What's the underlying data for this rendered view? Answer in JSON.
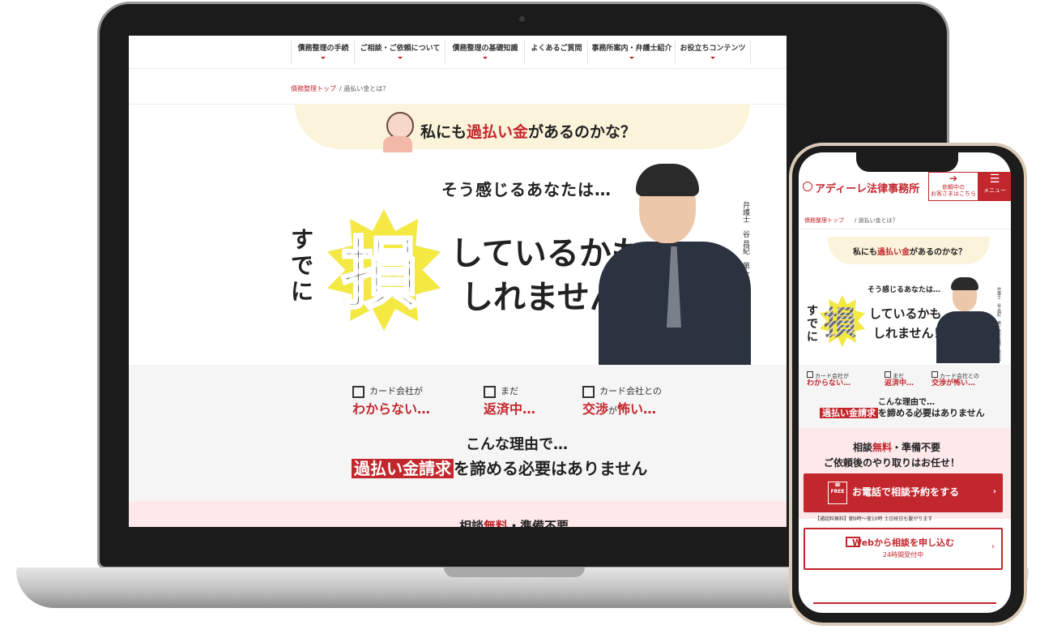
{
  "desktop": {
    "nav": [
      {
        "label": "債務整理の手続"
      },
      {
        "label": "ご相談・ご依頼について"
      },
      {
        "label": "債務整理の基礎知識"
      },
      {
        "label": "よくあるご質問"
      },
      {
        "label": "事務所案内・弁護士紹介"
      },
      {
        "label": "お役立ちコンテンツ"
      }
    ],
    "breadcrumb": {
      "home": "債務整理トップ",
      "separator": "/",
      "current": "過払い金とは？"
    },
    "hero": {
      "bubble_pre": "私にも",
      "bubble_hl": "過払い金",
      "bubble_post": "があるのかな？",
      "sou": "そう感じるあなたは…",
      "sude": "すでに",
      "son": "損",
      "line1": "しているかも",
      "line2": "しれません！",
      "lawyer": "弁護士　谷 昌紀　第一東京弁護士会所属"
    },
    "checks": [
      {
        "pre": "カード会社が",
        "main": "わからない…"
      },
      {
        "pre": "まだ",
        "main": "返済中…"
      },
      {
        "pre": "カード会社との",
        "main": "交渉",
        "suffix": "が",
        "main2": "怖い…"
      }
    ],
    "reason": "こんな理由で…",
    "claim_hl": "過払い金請求",
    "claim_rest": "を諦める必要はありません",
    "soudan_pre": "相談",
    "soudan_hl": "無料",
    "soudan_post": "・準備不要"
  },
  "mobile": {
    "logo": "アディーレ法律事務所",
    "client_btn": "依頼中の\nお客さまはこちら",
    "menu_btn": "メニュー",
    "breadcrumb": {
      "home": "債務整理トップ",
      "separator": "/",
      "current": "過払い金とは？"
    },
    "bubble_pre": "私にも",
    "bubble_hl": "過払い金",
    "bubble_post": "があるのかな？",
    "sou": "そう感じるあなたは…",
    "sude": "すでに",
    "son": "損",
    "line1": "しているかも",
    "line2": "しれません！",
    "lawyer": "弁護士　谷 昌紀　第一東京弁護士会所属",
    "checks": [
      {
        "pre": "カード会社が",
        "main": "わからない…"
      },
      {
        "pre": "まだ",
        "main": "返済中…"
      },
      {
        "pre": "カード会社との",
        "main": "交渉が怖い…"
      }
    ],
    "reason": "こんな理由で…",
    "claim_hl": "過払い金請求",
    "claim_rest": "を諦める必要はありません",
    "soudan1_pre": "相談",
    "soudan1_hl": "無料",
    "soudan1_post": "・準備不要",
    "soudan2": "ご依頼後のやり取りはお任せ！",
    "tel_label": "お電話で相談予約をする",
    "tel_free": "FREE",
    "tel_note": "【通話料無料】朝9時～夜10時 土日祝日も繋がります",
    "web_label": "Webから相談を申し込む",
    "web_sub": "24時間受付中"
  },
  "colors": {
    "accent": "#c2272d",
    "cream": "#fbf3da",
    "pink": "#fde8ea"
  },
  "icons": [
    "login-icon",
    "menu-icon",
    "phone-free-icon",
    "pc-icon",
    "chevron-right-icon",
    "checkbox-icon"
  ]
}
